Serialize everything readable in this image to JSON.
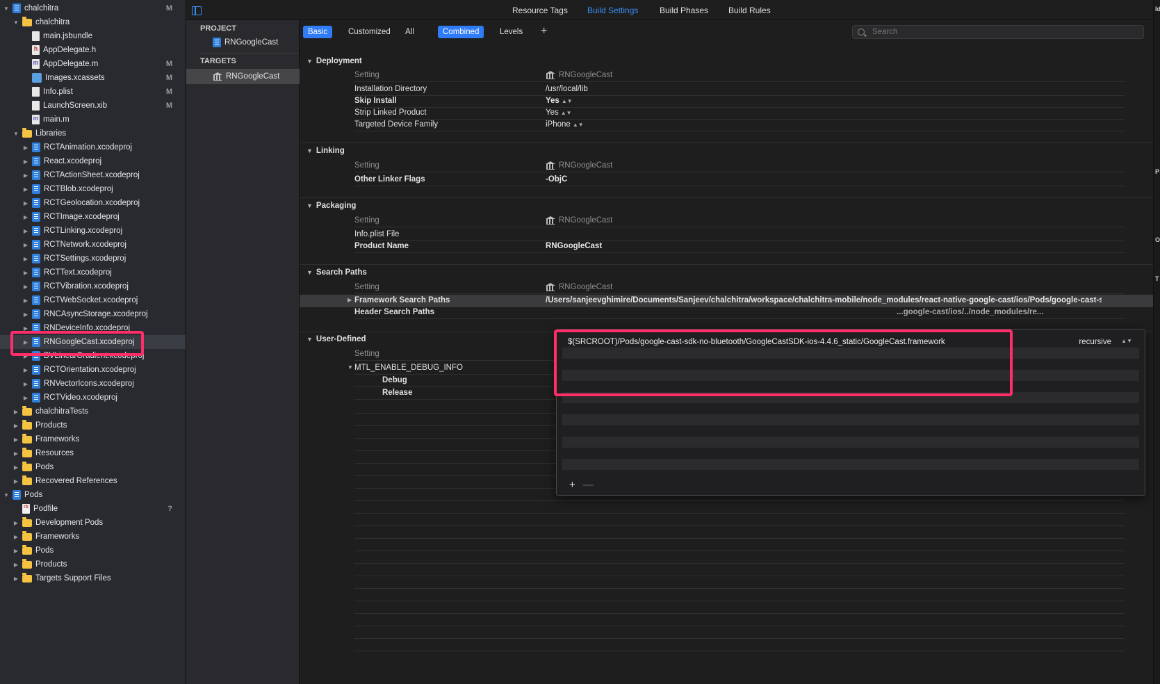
{
  "navigator": {
    "items": [
      {
        "label": "chalchitra",
        "icon": "proj",
        "depth": 0,
        "disclosure": "open",
        "badge": "M"
      },
      {
        "label": "chalchitra",
        "icon": "folder",
        "depth": 1,
        "disclosure": "open",
        "badge": ""
      },
      {
        "label": "main.jsbundle",
        "icon": "doc",
        "depth": 2,
        "disclosure": "",
        "badge": ""
      },
      {
        "label": "AppDelegate.h",
        "icon": "h",
        "depth": 2,
        "disclosure": "",
        "badge": ""
      },
      {
        "label": "AppDelegate.m",
        "icon": "m",
        "depth": 2,
        "disclosure": "",
        "badge": "M"
      },
      {
        "label": "Images.xcassets",
        "icon": "assets",
        "depth": 2,
        "disclosure": "",
        "badge": "M"
      },
      {
        "label": "Info.plist",
        "icon": "doc",
        "depth": 2,
        "disclosure": "",
        "badge": "M"
      },
      {
        "label": "LaunchScreen.xib",
        "icon": "doc",
        "depth": 2,
        "disclosure": "",
        "badge": "M"
      },
      {
        "label": "main.m",
        "icon": "m",
        "depth": 2,
        "disclosure": "",
        "badge": ""
      },
      {
        "label": "Libraries",
        "icon": "folder",
        "depth": 1,
        "disclosure": "open",
        "badge": ""
      },
      {
        "label": "RCTAnimation.xcodeproj",
        "icon": "proj",
        "depth": 2,
        "disclosure": "closed",
        "badge": ""
      },
      {
        "label": "React.xcodeproj",
        "icon": "proj",
        "depth": 2,
        "disclosure": "closed",
        "badge": ""
      },
      {
        "label": "RCTActionSheet.xcodeproj",
        "icon": "proj",
        "depth": 2,
        "disclosure": "closed",
        "badge": ""
      },
      {
        "label": "RCTBlob.xcodeproj",
        "icon": "proj",
        "depth": 2,
        "disclosure": "closed",
        "badge": ""
      },
      {
        "label": "RCTGeolocation.xcodeproj",
        "icon": "proj",
        "depth": 2,
        "disclosure": "closed",
        "badge": ""
      },
      {
        "label": "RCTImage.xcodeproj",
        "icon": "proj",
        "depth": 2,
        "disclosure": "closed",
        "badge": ""
      },
      {
        "label": "RCTLinking.xcodeproj",
        "icon": "proj",
        "depth": 2,
        "disclosure": "closed",
        "badge": ""
      },
      {
        "label": "RCTNetwork.xcodeproj",
        "icon": "proj",
        "depth": 2,
        "disclosure": "closed",
        "badge": ""
      },
      {
        "label": "RCTSettings.xcodeproj",
        "icon": "proj",
        "depth": 2,
        "disclosure": "closed",
        "badge": ""
      },
      {
        "label": "RCTText.xcodeproj",
        "icon": "proj",
        "depth": 2,
        "disclosure": "closed",
        "badge": ""
      },
      {
        "label": "RCTVibration.xcodeproj",
        "icon": "proj",
        "depth": 2,
        "disclosure": "closed",
        "badge": ""
      },
      {
        "label": "RCTWebSocket.xcodeproj",
        "icon": "proj",
        "depth": 2,
        "disclosure": "closed",
        "badge": ""
      },
      {
        "label": "RNCAsyncStorage.xcodeproj",
        "icon": "proj",
        "depth": 2,
        "disclosure": "closed",
        "badge": ""
      },
      {
        "label": "RNDeviceInfo.xcodeproj",
        "icon": "proj",
        "depth": 2,
        "disclosure": "closed",
        "badge": ""
      },
      {
        "label": "RNGoogleCast.xcodeproj",
        "icon": "proj",
        "depth": 2,
        "disclosure": "closed",
        "badge": "",
        "selected": true
      },
      {
        "label": "BVLinearGradient.xcodeproj",
        "icon": "proj",
        "depth": 2,
        "disclosure": "closed",
        "badge": ""
      },
      {
        "label": "RCTOrientation.xcodeproj",
        "icon": "proj",
        "depth": 2,
        "disclosure": "closed",
        "badge": ""
      },
      {
        "label": "RNVectorIcons.xcodeproj",
        "icon": "proj",
        "depth": 2,
        "disclosure": "closed",
        "badge": ""
      },
      {
        "label": "RCTVideo.xcodeproj",
        "icon": "proj",
        "depth": 2,
        "disclosure": "closed",
        "badge": ""
      },
      {
        "label": "chalchitraTests",
        "icon": "folder",
        "depth": 1,
        "disclosure": "closed",
        "badge": ""
      },
      {
        "label": "Products",
        "icon": "folder",
        "depth": 1,
        "disclosure": "closed",
        "badge": ""
      },
      {
        "label": "Frameworks",
        "icon": "folder",
        "depth": 1,
        "disclosure": "closed",
        "badge": ""
      },
      {
        "label": "Resources",
        "icon": "folder",
        "depth": 1,
        "disclosure": "closed",
        "badge": ""
      },
      {
        "label": "Pods",
        "icon": "folder",
        "depth": 1,
        "disclosure": "closed",
        "badge": ""
      },
      {
        "label": "Recovered References",
        "icon": "folder",
        "depth": 1,
        "disclosure": "closed",
        "badge": ""
      },
      {
        "label": "Pods",
        "icon": "proj",
        "depth": 0,
        "disclosure": "open",
        "badge": ""
      },
      {
        "label": "Podfile",
        "icon": "podfile",
        "depth": 1,
        "disclosure": "",
        "badge": "?"
      },
      {
        "label": "Development Pods",
        "icon": "folder",
        "depth": 1,
        "disclosure": "closed",
        "badge": ""
      },
      {
        "label": "Frameworks",
        "icon": "folder",
        "depth": 1,
        "disclosure": "closed",
        "badge": ""
      },
      {
        "label": "Pods",
        "icon": "folder",
        "depth": 1,
        "disclosure": "closed",
        "badge": ""
      },
      {
        "label": "Products",
        "icon": "folder",
        "depth": 1,
        "disclosure": "closed",
        "badge": ""
      },
      {
        "label": "Targets Support Files",
        "icon": "folder",
        "depth": 1,
        "disclosure": "closed",
        "badge": ""
      }
    ]
  },
  "targets_list": {
    "project_header": "PROJECT",
    "project_item": "RNGoogleCast",
    "targets_header": "TARGETS",
    "target_item": "RNGoogleCast"
  },
  "tabs": {
    "resource_tags": "Resource Tags",
    "build_settings": "Build Settings",
    "build_phases": "Build Phases",
    "build_rules": "Build Rules"
  },
  "filter": {
    "basic": "Basic",
    "customized": "Customized",
    "all": "All",
    "combined": "Combined",
    "levels": "Levels",
    "add": "+",
    "search_placeholder": "Search"
  },
  "columns": {
    "setting": "Setting",
    "target": "RNGoogleCast"
  },
  "sections": {
    "deployment": {
      "title": "Deployment",
      "rows": [
        {
          "key": "Installation Directory",
          "value": "/usr/local/lib"
        },
        {
          "key": "Skip Install",
          "value": "Yes"
        },
        {
          "key": "Strip Linked Product",
          "value": "Yes"
        },
        {
          "key": "Targeted Device Family",
          "value": "iPhone"
        }
      ]
    },
    "linking": {
      "title": "Linking",
      "rows": [
        {
          "key": "Other Linker Flags",
          "value": "-ObjC"
        }
      ]
    },
    "packaging": {
      "title": "Packaging",
      "rows": [
        {
          "key": "Info.plist File",
          "value": ""
        },
        {
          "key": "Product Name",
          "value": "RNGoogleCast"
        }
      ]
    },
    "search_paths": {
      "title": "Search Paths",
      "rows": [
        {
          "key": "Framework Search Paths",
          "value": "/Users/sanjeevghimire/Documents/Sanjeev/chalchitra/workspace/chalchitra-mobile/node_modules/react-native-google-cast/ios/Pods/google-cast-s..."
        },
        {
          "key": "Header Search Paths",
          "value": "...google-cast/ios/../node_modules/re..."
        }
      ]
    },
    "user_defined": {
      "title": "User-Defined",
      "rows": [
        {
          "key": "MTL_ENABLE_DEBUG_INFO",
          "value": ""
        },
        {
          "key": "Debug",
          "value": ""
        },
        {
          "key": "Release",
          "value": ""
        }
      ]
    }
  },
  "popover": {
    "path": "$(SRCROOT)/Pods/google-cast-sdk-no-bluetooth/GoogleCastSDK-ios-4.4.6_static/GoogleCast.framework",
    "recursive": "recursive",
    "add": "+",
    "remove": "—"
  },
  "inspector_edge": {
    "labels": [
      "Id",
      "P",
      "O",
      "T"
    ]
  },
  "colors": {
    "accent": "#2f7cf6",
    "annotation": "#ff2d6a",
    "navigator_bg": "#292a30",
    "content_bg": "#1e1e1e"
  }
}
